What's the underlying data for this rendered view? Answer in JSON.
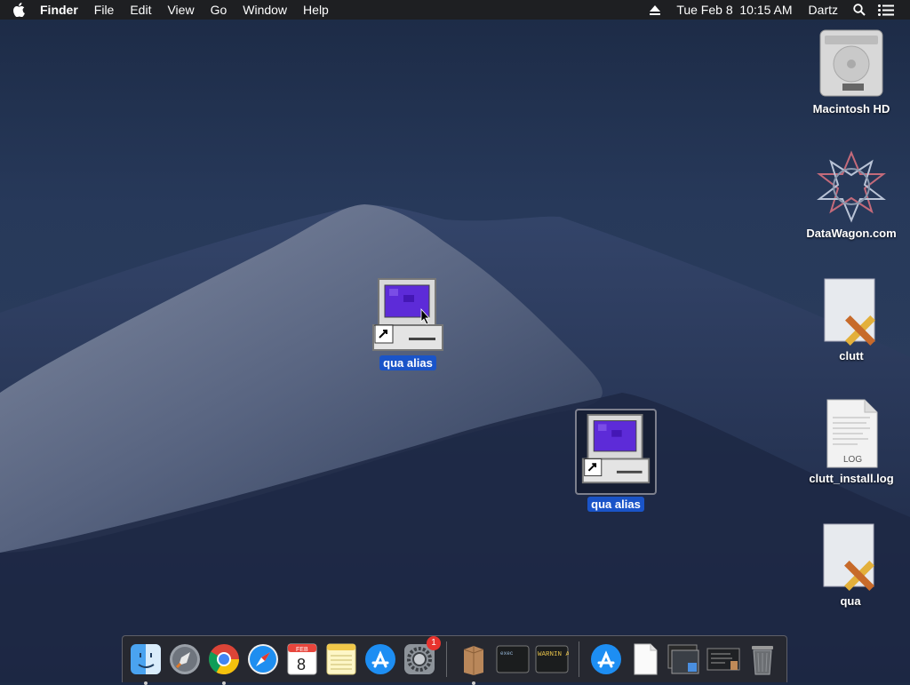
{
  "menubar": {
    "app_name": "Finder",
    "menus": [
      "File",
      "Edit",
      "View",
      "Go",
      "Window",
      "Help"
    ],
    "clock": "Tue Feb 8  10:15 AM",
    "user": "Dartz"
  },
  "desktop": {
    "right_icons": [
      {
        "label": "Macintosh HD",
        "icon": "hard-drive-icon"
      },
      {
        "label": "DataWagon.com",
        "icon": "network-share-icon"
      },
      {
        "label": "clutt",
        "icon": "script-document-icon"
      },
      {
        "label": "clutt_install.log",
        "icon": "log-document-icon",
        "badge": "LOG"
      },
      {
        "label": "qua",
        "icon": "script-document-icon"
      }
    ],
    "alias_icons": [
      {
        "label": "qua alias",
        "icon": "retro-computer-alias-icon"
      },
      {
        "label": "qua alias",
        "icon": "retro-computer-alias-icon"
      }
    ]
  },
  "dock": {
    "items": [
      {
        "name": "Finder",
        "icon": "finder-icon",
        "running": true
      },
      {
        "name": "Launchpad",
        "icon": "launchpad-icon",
        "running": false
      },
      {
        "name": "Google Chrome",
        "icon": "chrome-icon",
        "running": true
      },
      {
        "name": "Safari",
        "icon": "safari-icon",
        "running": false
      },
      {
        "name": "Calendar",
        "icon": "calendar-icon",
        "running": false,
        "month": "FEB",
        "day": "8"
      },
      {
        "name": "Notes",
        "icon": "notes-icon",
        "running": false
      },
      {
        "name": "App Store",
        "icon": "app-store-icon",
        "running": false
      },
      {
        "name": "System Preferences",
        "icon": "system-preferences-icon",
        "running": false,
        "badge": "1"
      },
      {
        "name": "Archive",
        "icon": "archive-box-icon",
        "running": true
      },
      {
        "name": "Terminal",
        "icon": "terminal-icon",
        "running": false,
        "text": "exec"
      },
      {
        "name": "Console",
        "icon": "console-icon",
        "running": false,
        "text": "WARNIN AY 7:36"
      },
      {
        "name": "Applications",
        "icon": "applications-folder-icon"
      },
      {
        "name": "Documents",
        "icon": "document-icon"
      },
      {
        "name": "Downloads",
        "icon": "downloads-stack-icon"
      },
      {
        "name": "Screenshots",
        "icon": "screenshots-stack-icon"
      },
      {
        "name": "Trash",
        "icon": "trash-icon"
      }
    ]
  }
}
